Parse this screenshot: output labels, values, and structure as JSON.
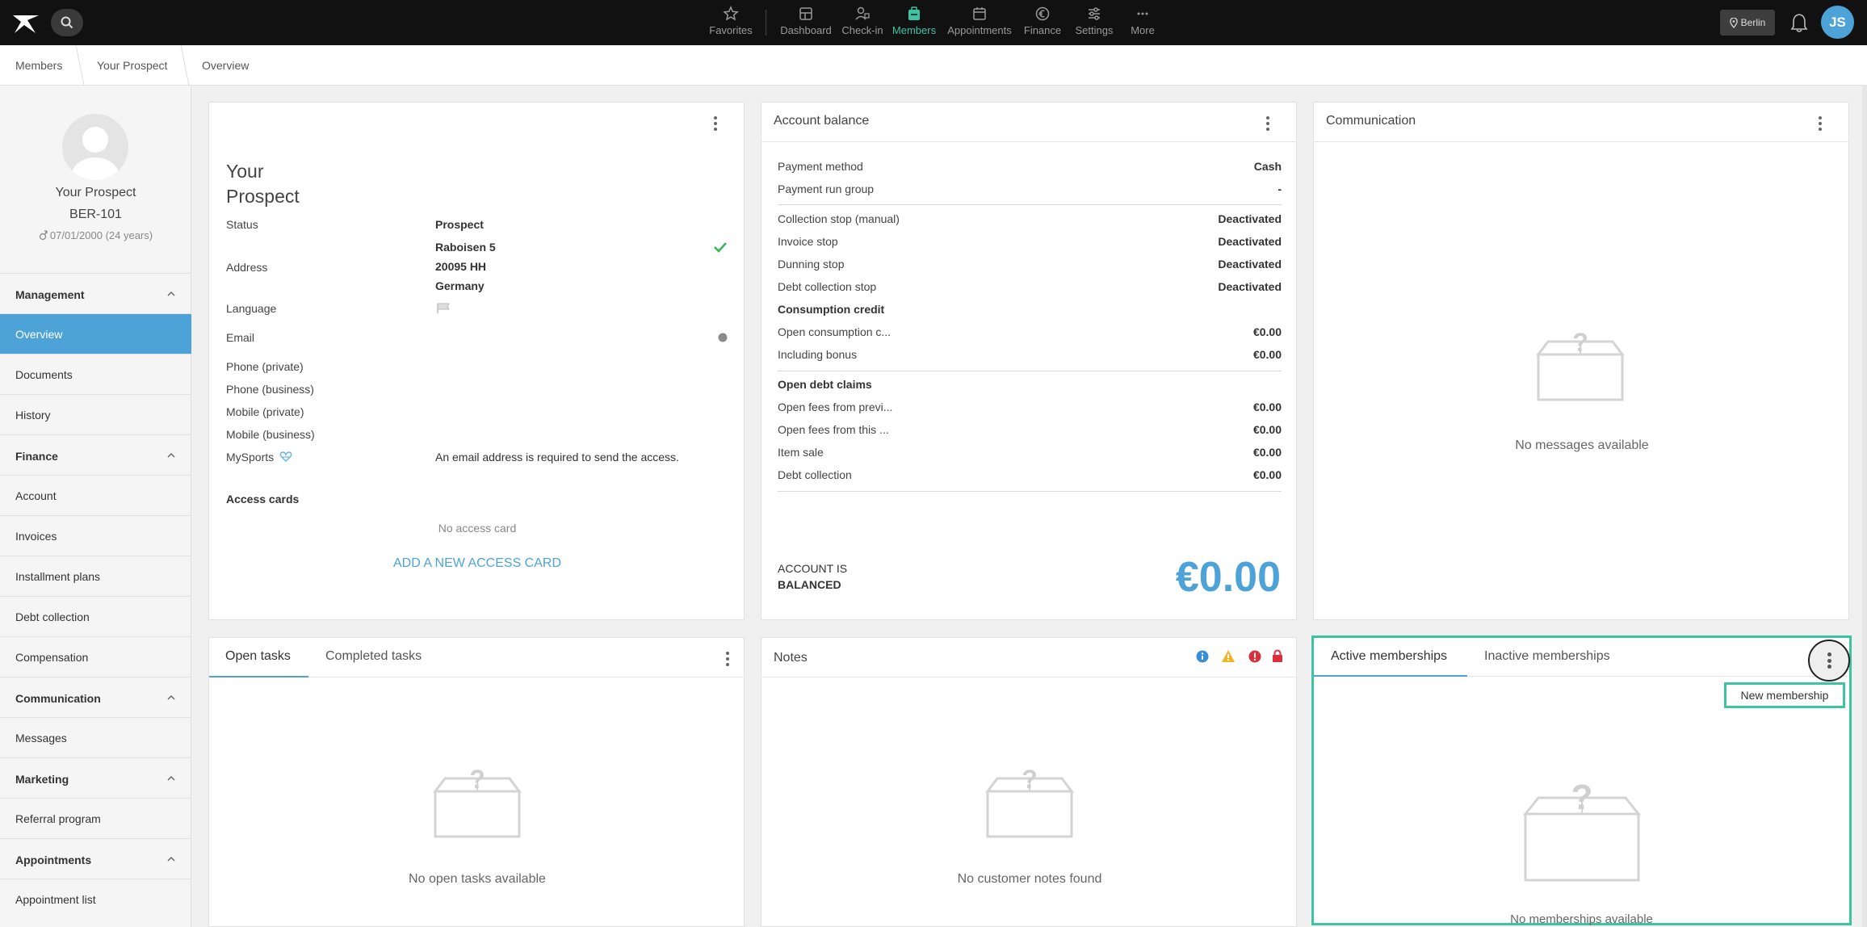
{
  "topbar": {
    "nav": [
      {
        "label": "Favorites",
        "icon": "star-icon"
      },
      {
        "label": "Dashboard",
        "icon": "dashboard-icon"
      },
      {
        "label": "Check-in",
        "icon": "check-in-icon"
      },
      {
        "label": "Members",
        "icon": "members-icon"
      },
      {
        "label": "Appointments",
        "icon": "calendar-icon"
      },
      {
        "label": "Finance",
        "icon": "euro-icon"
      },
      {
        "label": "Settings",
        "icon": "sliders-icon"
      },
      {
        "label": "More",
        "icon": "more-icon"
      }
    ],
    "active_nav": "Members",
    "location": "Berlin",
    "user_initials": "JS"
  },
  "breadcrumb": [
    "Members",
    "Your Prospect",
    "Overview"
  ],
  "sidebar": {
    "name": "Your Prospect",
    "member_id": "BER-101",
    "dob": "07/01/2000 (24 years)",
    "sections": [
      {
        "title": "Management",
        "items": [
          "Overview",
          "Documents",
          "History"
        ]
      },
      {
        "title": "Finance",
        "items": [
          "Account",
          "Invoices",
          "Installment plans",
          "Debt collection",
          "Compensation"
        ]
      },
      {
        "title": "Communication",
        "items": [
          "Messages"
        ]
      },
      {
        "title": "Marketing",
        "items": [
          "Referral program"
        ]
      },
      {
        "title": "Appointments",
        "items": [
          "Appointment list"
        ]
      }
    ],
    "active_item": "Overview"
  },
  "profile_card": {
    "name_line1": "Your",
    "name_line2": "Prospect",
    "status_label": "Status",
    "status_value": "Prospect",
    "address_label": "Address",
    "address_lines": [
      "Raboisen 5",
      "20095 HH",
      "Germany"
    ],
    "language_label": "Language",
    "email_label": "Email",
    "phone_private_label": "Phone (private)",
    "phone_business_label": "Phone (business)",
    "mobile_private_label": "Mobile (private)",
    "mobile_business_label": "Mobile (business)",
    "mysports_label": "MySports",
    "mysports_value": "An email address is required to send the access.",
    "access_cards_label": "Access cards",
    "no_access_card": "No access card",
    "add_card_link": "ADD A NEW ACCESS CARD"
  },
  "account_balance": {
    "title": "Account balance",
    "rows": [
      {
        "label": "Payment method",
        "value": "Cash"
      },
      {
        "label": "Payment run group",
        "value": "-"
      },
      {
        "label": "Collection stop (manual)",
        "value": "Deactivated"
      },
      {
        "label": "Invoice stop",
        "value": "Deactivated"
      },
      {
        "label": "Dunning stop",
        "value": "Deactivated"
      },
      {
        "label": "Debt collection stop",
        "value": "Deactivated"
      },
      {
        "label": "Consumption credit",
        "value": ""
      },
      {
        "label": "Open consumption c...",
        "value": "€0.00"
      },
      {
        "label": "Including bonus",
        "value": "€0.00"
      },
      {
        "label": "Open debt claims",
        "value": ""
      },
      {
        "label": "Open fees from previ...",
        "value": "€0.00"
      },
      {
        "label": "Open fees from this ...",
        "value": "€0.00"
      },
      {
        "label": "Item sale",
        "value": "€0.00"
      },
      {
        "label": "Debt collection",
        "value": "€0.00"
      }
    ],
    "status_line1": "ACCOUNT IS",
    "status_line2": "BALANCED",
    "total": "€0.00"
  },
  "communication": {
    "title": "Communication",
    "empty": "No messages available"
  },
  "tasks": {
    "tab_open": "Open tasks",
    "tab_completed": "Completed tasks",
    "empty": "No open tasks available"
  },
  "notes": {
    "title": "Notes",
    "empty": "No customer notes found"
  },
  "memberships": {
    "tab_active": "Active memberships",
    "tab_inactive": "Inactive memberships",
    "new_button": "New membership",
    "empty": "No memberships available"
  },
  "colors": {
    "accent": "#4da3d8",
    "active_nav": "#3cc3a0",
    "highlight": "#3cc3a0"
  }
}
